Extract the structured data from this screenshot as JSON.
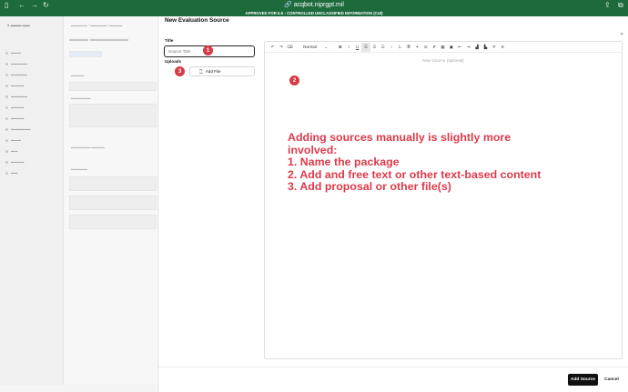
{
  "browser": {
    "url": "acqbot.niprgpt.mil",
    "icons": [
      "sidebar-icon",
      "back-icon",
      "forward-icon",
      "reload-icon",
      "share-icon",
      "tabs-icon"
    ]
  },
  "banner": {
    "text": "APPROVED FOR IL5 - CONTROLLED UNCLASSIFIED INFORMATION (CUI)"
  },
  "modal": {
    "title": "New Evaluation Source",
    "title_label": "Title",
    "title_placeholder": "Source Title",
    "uploads_label": "Uploads",
    "add_file_label": "Add File",
    "editor": {
      "format_select": "Normal",
      "placeholder": "New Source (optional)"
    },
    "add_source_label": "Add Source",
    "cancel_label": "Cancel"
  },
  "badges": [
    "1",
    "2",
    "3"
  ],
  "annotation": {
    "lines": [
      "Adding sources manually is slightly more",
      "involved:",
      "1. Name the package",
      "2. Add and free text or other text-based content",
      "3. Add proposal or other file(s)"
    ],
    "color": "#dd3a4a"
  },
  "colors": {
    "brand_green": "#1d6b3d",
    "badge_red": "#d83a46",
    "primary_button": "#111111"
  }
}
